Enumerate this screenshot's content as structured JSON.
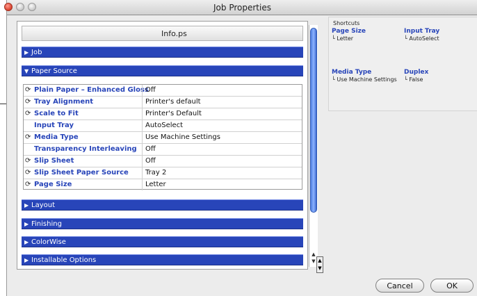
{
  "window": {
    "title": "Job Properties"
  },
  "document": {
    "filename": "Info.ps"
  },
  "sections": {
    "job": "Job",
    "paper_source": "Paper Source",
    "layout": "Layout",
    "finishing": "Finishing",
    "colorwise": "ColorWise",
    "installable": "Installable Options"
  },
  "paper_source_rows": [
    {
      "label": "Plain Paper – Enhanced Gloss",
      "value": "Off",
      "icon": "refresh-icon"
    },
    {
      "label": "Tray Alignment",
      "value": "Printer's default",
      "icon": "refresh-icon"
    },
    {
      "label": "Scale to Fit",
      "value": "Printer's Default",
      "icon": "refresh-icon"
    },
    {
      "label": "Input Tray",
      "value": "AutoSelect",
      "icon": ""
    },
    {
      "label": "Media Type",
      "value": "Use Machine Settings",
      "icon": "refresh-icon"
    },
    {
      "label": "Transparency Interleaving",
      "value": "Off",
      "icon": ""
    },
    {
      "label": "Slip Sheet",
      "value": "Off",
      "icon": "refresh-icon"
    },
    {
      "label": "Slip Sheet Paper Source",
      "value": "Tray 2",
      "icon": "refresh-icon"
    },
    {
      "label": "Page Size",
      "value": "Letter",
      "icon": "refresh-icon"
    }
  ],
  "shortcuts": {
    "title": "Shortcuts",
    "items": [
      {
        "label": "Page Size",
        "value": "└ Letter"
      },
      {
        "label": "Input Tray",
        "value": "└ AutoSelect"
      },
      {
        "label": "Media Type",
        "value": "└ Use Machine Settings"
      },
      {
        "label": "Duplex",
        "value": "└ False"
      }
    ]
  },
  "buttons": {
    "cancel": "Cancel",
    "ok": "OK"
  },
  "colors": {
    "section_blue": "#2845b9",
    "label_blue": "#2845b9"
  }
}
